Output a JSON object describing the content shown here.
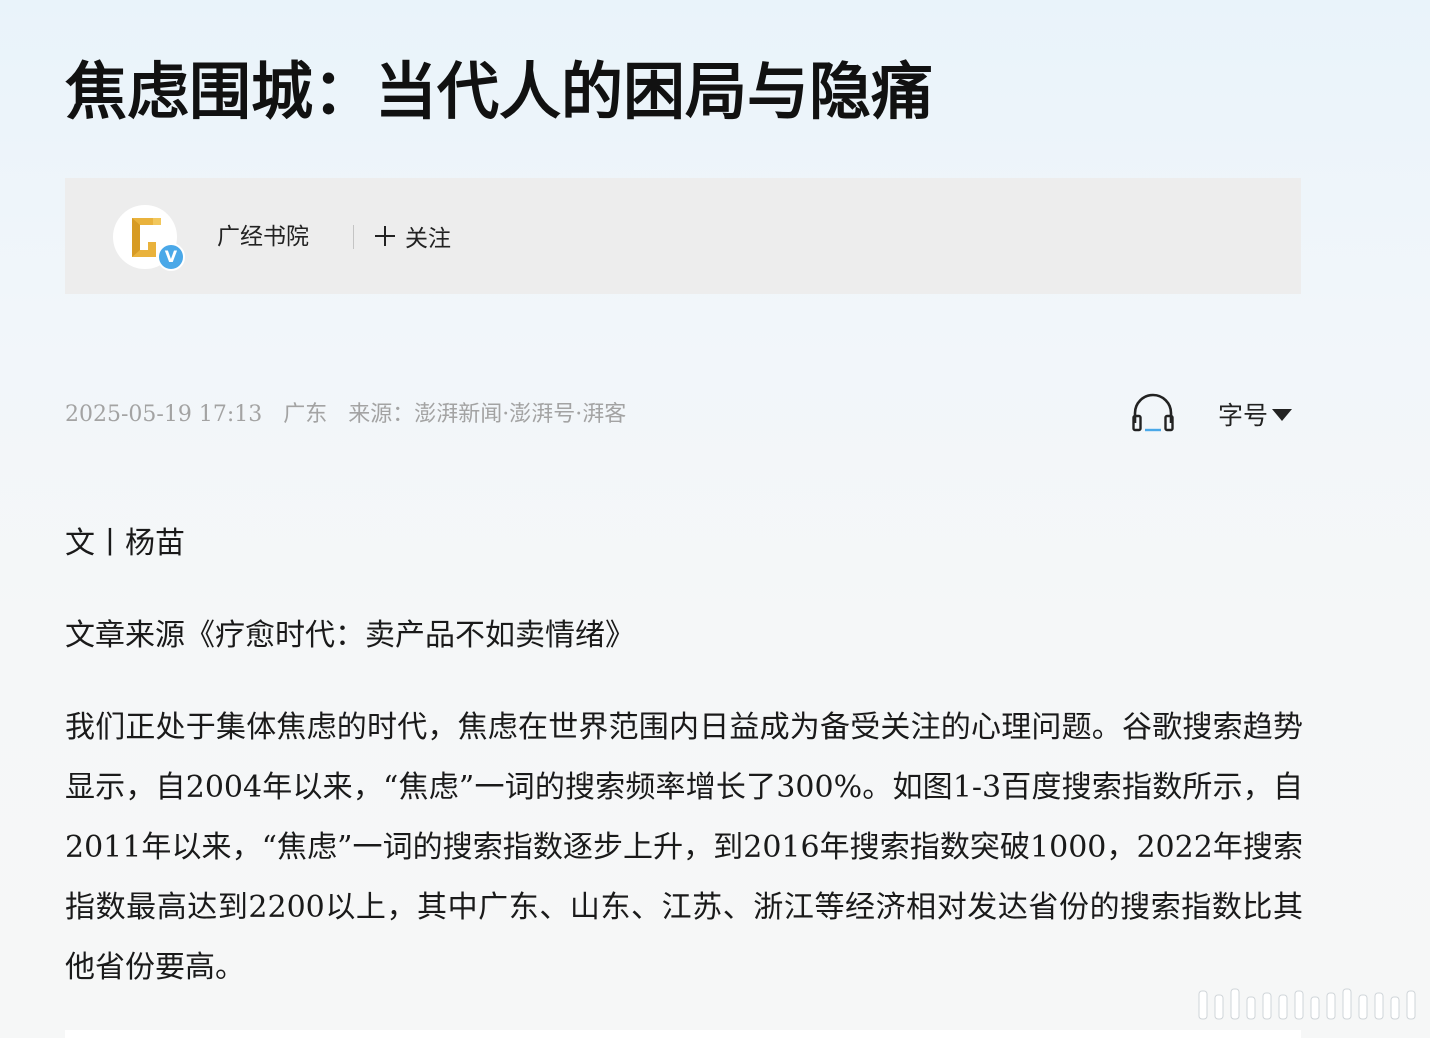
{
  "article": {
    "title": "焦虑围城：当代人的困局与隐痛"
  },
  "author": {
    "name": "广经书院",
    "verified_mark": "V",
    "follow_label": "关注"
  },
  "meta": {
    "datetime": "2025-05-19 17:13",
    "location": "广东",
    "source": "来源：澎湃新闻·澎湃号·湃客"
  },
  "toolbar": {
    "listen_icon": "headphone-icon",
    "font_size_label": "字号"
  },
  "body": {
    "byline": "文丨杨苗",
    "source_line": "文章来源《疗愈时代：卖产品不如卖情绪》",
    "paragraph_1": "我们正处于集体焦虑的时代，焦虑在世界范围内日益成为备受关注的心理问题。谷歌搜索趋势显示，自2004年以来，“焦虑”一词的搜索频率增长了300%。如图1-3百度搜索指数所示，自2011年以来，“焦虑”一词的搜索指数逐步上升，到2016年搜索指数突破1000，2022年搜索指数最高达到2200以上，其中广东、山东、江苏、浙江等经济相对发达省份的搜索指数比其他省份要高。"
  },
  "colors": {
    "avatar_logo": "#e9b23c",
    "verified_badge": "#4aa8e8",
    "meta_text": "#a3a3a3",
    "card_bg": "#ededed"
  }
}
